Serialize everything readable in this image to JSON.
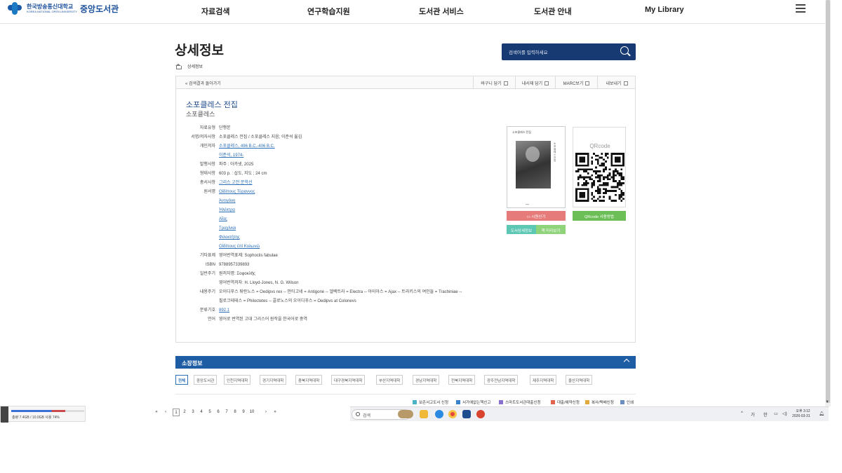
{
  "header": {
    "logo_kr": "한국방송통신대학교",
    "logo_en": "KOREA NATIONAL OPEN UNIVERSITY",
    "logo_lib": "중앙도서관",
    "menu": [
      "자료검색",
      "연구학습지원",
      "도서관 서비스",
      "도서관 안내",
      "My Library"
    ]
  },
  "page": {
    "title": "상세정보",
    "breadcrumb": "상세정보",
    "search_placeholder": "검색어를 입력하세요"
  },
  "toolbar": {
    "back": "« 검색결과 돌아가기",
    "buttons": [
      "바구니 담기",
      "내서재 담기",
      "MARC보기",
      "내보내기"
    ]
  },
  "book": {
    "title": "소포클레스 전집",
    "author": "소포클레스",
    "fields": [
      {
        "label": "자료유형",
        "value": "단행본"
      },
      {
        "label": "서명/저자사항",
        "value": "소포클레스 전집 / 소포클레스 지음; 이준석 옮김"
      },
      {
        "label": "개인저자",
        "value": "소포클레스, 496 B.C.-406 B.C."
      },
      {
        "label": "",
        "value": "이준석, 1974-"
      },
      {
        "label": "발행사항",
        "value": "파주 : 아카넷, 2025"
      },
      {
        "label": "형태사항",
        "value": "603 p. : 삽도, 지도 ; 24 cm"
      },
      {
        "label": "총서사항",
        "value": "그리스 고전 문학선"
      },
      {
        "label": "원서명",
        "value": "Οἰδίπους Τύραννος"
      },
      {
        "label": "",
        "value": "Ἀντιγόνη"
      },
      {
        "label": "",
        "value": "Ἠλέκτρα"
      },
      {
        "label": "",
        "value": "Αἴας"
      },
      {
        "label": "",
        "value": "Τραχίνιαι"
      },
      {
        "label": "",
        "value": "Φιλοκτήτης"
      },
      {
        "label": "",
        "value": "Οἰδίπους ἐπὶ Κολωνῷ"
      },
      {
        "label": "기타표제",
        "value": "영어번역표제: Sophoclis fabulae"
      },
      {
        "label": "ISBN",
        "value": "9788957339893"
      },
      {
        "label": "일반주기",
        "value": "원저자명: Σοφοκλῆς"
      },
      {
        "label": "",
        "value": "영어번역저자: H. Lloyd-Jones, N. G. Wilson"
      },
      {
        "label": "내용주기",
        "value": "오이디푸스 튀란노스 = Oedipvs rex -- 안티고네 = Antigone -- 엘렉트라 = Electra -- 아이아스 = Ajax -- 트라키스의 여인들 = Trachiniae --"
      },
      {
        "label": "",
        "value": "필로크테테스 = Philoctetes -- 콜로노스의 오이디푸스 = Oedipvs at Colonevs"
      },
      {
        "label": "분류기호",
        "value": "892.1"
      },
      {
        "label": "언어",
        "value": "영어로 번역된 고대 그리스어 원작을 한국어로 중역"
      }
    ],
    "cover_title": "소포클레스 전집",
    "cover_dash": "—",
    "qr_title": "QRcode"
  },
  "buttons": {
    "request": "시원신기",
    "qr_usage": "QRcode 사용방법",
    "detail": "도서상세정보",
    "preview": "책 미리보기"
  },
  "holdings": {
    "title": "소장정보",
    "branches": [
      "전체",
      "중앙도서관",
      "인천지역대학",
      "경기지역대학",
      "충북지역대학",
      "대구경북지역대학",
      "부산지역대학",
      "경남지역대학",
      "전북지역대학",
      "광주전남지역대학",
      "제주지역대학",
      "울산지역대학"
    ],
    "actions": [
      "보존서고도서 신청",
      "서가에없는책신고",
      "스마트도서관대출신청",
      "대출/예약신청",
      "복사/택배신청",
      "인쇄"
    ]
  },
  "pager": {
    "first": "«",
    "prev": "‹",
    "pages": [
      "1",
      "2",
      "3",
      "4",
      "5",
      "6",
      "7",
      "8",
      "9",
      "10"
    ],
    "next": "›",
    "last": "»",
    "current": "1"
  },
  "memory": {
    "text": "총량 7.4GB / 10.0GB 사용 74%",
    "used_pct": 74
  },
  "taskbar": {
    "search_label": "검색",
    "tray": [
      "^",
      "가",
      "한"
    ],
    "time": "오후 3:12",
    "date": "2026-03-31"
  },
  "colors": {
    "nav_dark": "#173a73",
    "holdings_bar": "#1e5ca4",
    "link": "#2a6fb8",
    "btn_red": "#e57b7b",
    "btn_green": "#6cbf56"
  }
}
